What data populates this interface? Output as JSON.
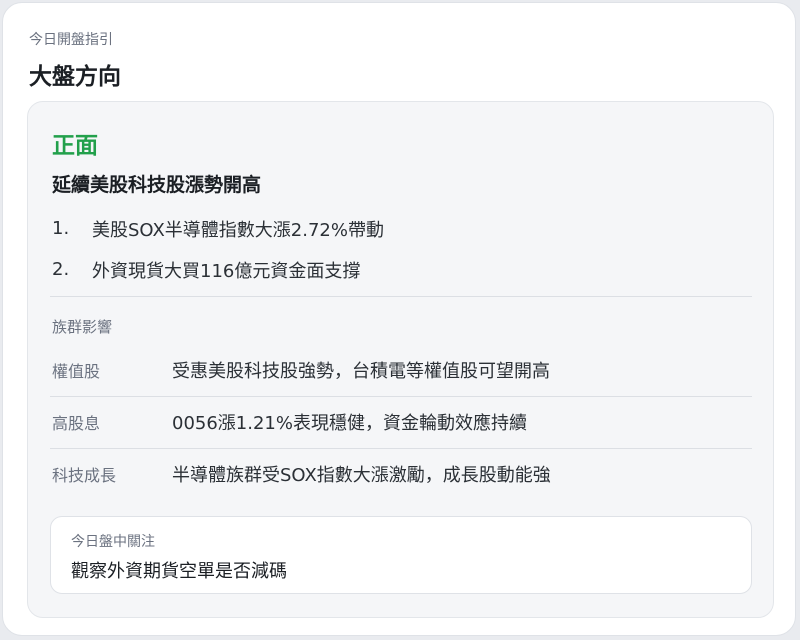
{
  "card": {
    "eyebrow": "今日開盤指引",
    "title": "大盤方向"
  },
  "outlook": {
    "sentiment": "正面",
    "sentiment_color": "#22a04b",
    "headline": "延續美股科技股漲勢開高",
    "reasons": [
      {
        "num": "1.",
        "text": "美股SOX半導體指數大漲2.72%帶動"
      },
      {
        "num": "2.",
        "text": "外資現貨大買116億元資金面支撐"
      }
    ]
  },
  "sectors": {
    "heading": "族群影響",
    "rows": [
      {
        "name": "權值股",
        "desc": "受惠美股科技股強勢，台積電等權值股可望開高"
      },
      {
        "name": "高股息",
        "desc": "0056漲1.21%表現穩健，資金輪動效應持續"
      },
      {
        "name": "科技成長",
        "desc": "半導體族群受SOX指數大漲激勵，成長股動能強"
      }
    ]
  },
  "focus": {
    "label": "今日盤中關注",
    "text": "觀察外資期貨空單是否減碼"
  }
}
